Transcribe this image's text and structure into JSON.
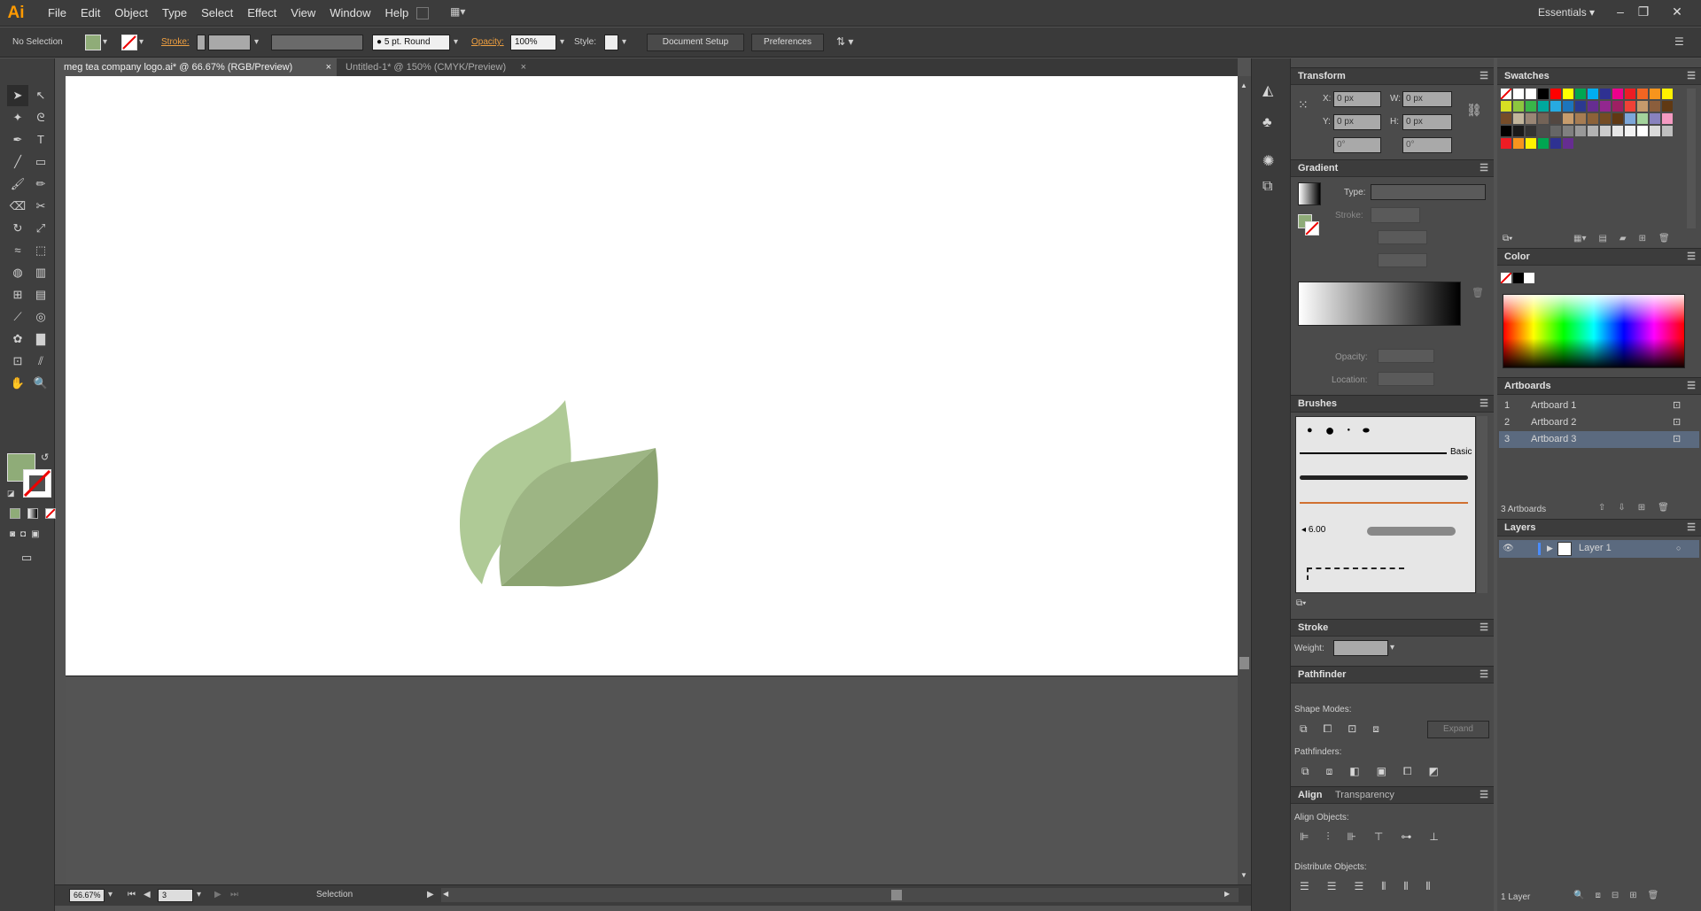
{
  "app": {
    "logo": "Ai",
    "workspace": "Essentials"
  },
  "menu": [
    "File",
    "Edit",
    "Object",
    "Type",
    "Select",
    "Effect",
    "View",
    "Window",
    "Help"
  ],
  "control": {
    "selection": "No Selection",
    "stroke_label": "Stroke:",
    "brush": "5 pt. Round",
    "opacity_label": "Opacity:",
    "opacity": "100%",
    "style_label": "Style:",
    "document_setup": "Document Setup",
    "preferences": "Preferences"
  },
  "tabs": [
    "meg tea company logo.ai* @ 66.67% (RGB/Preview)",
    "Untitled-1* @ 150% (CMYK/Preview)"
  ],
  "colors": {
    "fill": "#8fac78",
    "leaf_light": "#afca96",
    "leaf_mid": "#9db584",
    "leaf_dark": "#8ba370"
  },
  "transform": {
    "title": "Transform",
    "x_label": "X:",
    "x": "0 px",
    "y_label": "Y:",
    "y": "0 px",
    "w_label": "W:",
    "w": "0 px",
    "h_label": "H:",
    "h": "0 px",
    "angle": "0°",
    "shear": "0°"
  },
  "gradient": {
    "title": "Gradient",
    "type_label": "Type:",
    "stroke_label": "Stroke:",
    "opacity_label": "Opacity:",
    "location_label": "Location:"
  },
  "brushes": {
    "title": "Brushes",
    "basic_label": "Basic",
    "size": "6.00"
  },
  "stroke": {
    "title": "Stroke",
    "weight_label": "Weight:"
  },
  "pathfinder": {
    "title": "Pathfinder",
    "shape_modes": "Shape Modes:",
    "expand": "Expand",
    "pathfinders": "Pathfinders:"
  },
  "align": {
    "title": "Align",
    "tab2": "Transparency",
    "align_objects": "Align Objects:",
    "distribute_objects": "Distribute Objects:"
  },
  "swatches": {
    "title": "Swatches"
  },
  "color_panel": {
    "title": "Color"
  },
  "artboards": {
    "title": "Artboards",
    "items": [
      {
        "num": "1",
        "name": "Artboard 1"
      },
      {
        "num": "2",
        "name": "Artboard 2"
      },
      {
        "num": "3",
        "name": "Artboard 3"
      }
    ],
    "count": "3 Artboards"
  },
  "layers": {
    "title": "Layers",
    "items": [
      {
        "name": "Layer 1"
      }
    ],
    "count": "1 Layer"
  },
  "status": {
    "zoom": "66.67%",
    "artboard": "3",
    "tool": "Selection"
  }
}
